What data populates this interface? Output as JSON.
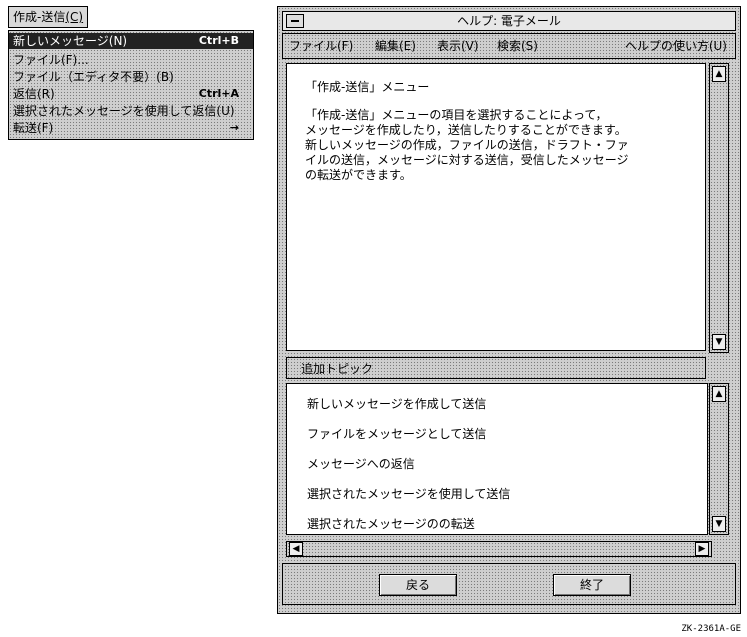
{
  "menu": {
    "title": "作成-送信",
    "title_mnemonic": "(C)",
    "items": [
      {
        "label": "新しいメッセージ(N)",
        "accel": "Ctrl+B",
        "highlighted": true
      },
      {
        "label": "ファイル(F)...",
        "accel": ""
      },
      {
        "label": "ファイル（エディタ不要）(B)",
        "accel": ""
      },
      {
        "label": "返信(R)",
        "accel": "Ctrl+A"
      },
      {
        "label": "選択されたメッセージを使用して返信(U)",
        "accel": ""
      },
      {
        "label": "転送(F)",
        "accel": "→"
      }
    ]
  },
  "window": {
    "title": "ヘルプ: 電子メール",
    "menubar": {
      "file": "ファイル(F)",
      "edit": "編集(E)",
      "view": "表示(V)",
      "search": "検索(S)",
      "howto": "ヘルプの使い方(U)"
    },
    "help_text": {
      "heading": "「作成-送信」メニュー",
      "body": "「作成-送信」メニューの項目を選択することによって，\nメッセージを作成したり，送信したりすることができます。\n新しいメッセージの作成，ファイルの送信，ドラフト・ファ\nイルの送信，メッセージに対する送信，受信したメッセージ\nの転送ができます。"
    },
    "additional_topics_label": "追加トピック",
    "topics": [
      "新しいメッセージを作成して送信",
      "ファイルをメッセージとして送信",
      "メッセージへの返信",
      "選択されたメッセージを使用して送信",
      "選択されたメッセージのの転送"
    ],
    "buttons": {
      "back": "戻る",
      "exit": "終了"
    }
  },
  "caption": "ZK-2361A-GE"
}
